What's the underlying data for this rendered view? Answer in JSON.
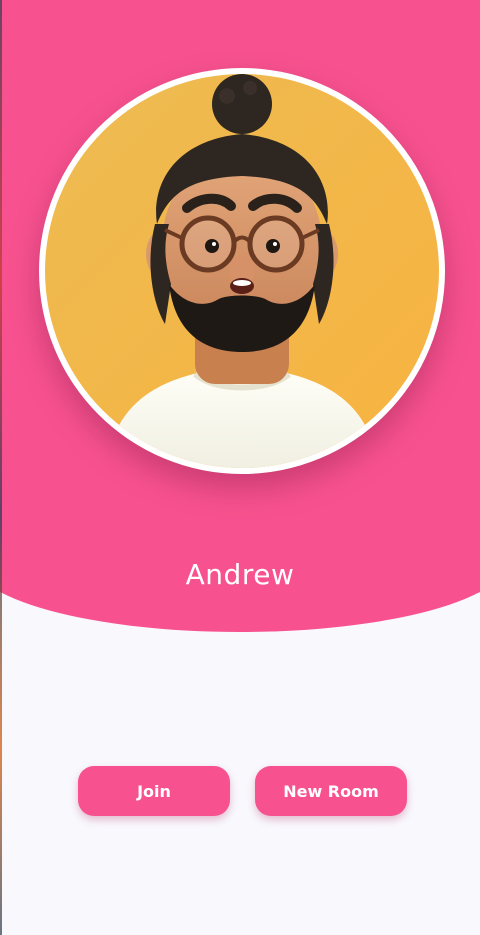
{
  "profile": {
    "name": "Andrew",
    "avatar_icon": "user-avatar-illustration"
  },
  "actions": {
    "join_label": "Join",
    "new_room_label": "New Room"
  },
  "colors": {
    "accent": "#F7528F",
    "background": "#F8F8FD",
    "avatar_background": "#F5B93E"
  }
}
